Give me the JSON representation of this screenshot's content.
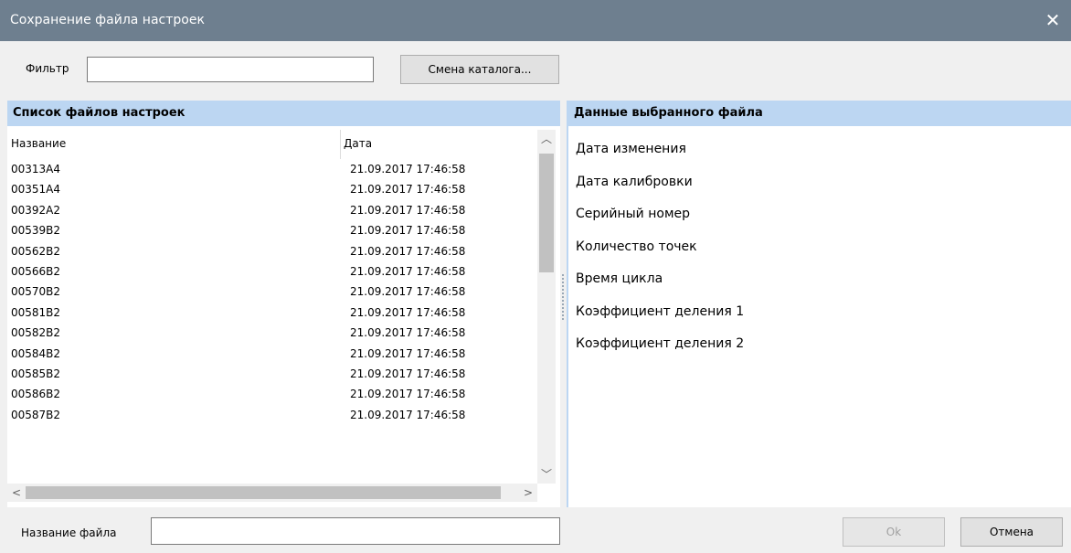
{
  "window": {
    "title": "Сохранение файла настроек",
    "close_glyph": "✕"
  },
  "toolbar": {
    "filter_label": "Фильтр",
    "filter_value": "",
    "change_dir_label": "Смена каталога..."
  },
  "file_list": {
    "header": "Список файлов настроек",
    "columns": [
      "Название",
      "Дата"
    ],
    "rows": [
      {
        "name": "00313A4",
        "date": "21.09.2017 17:46:58"
      },
      {
        "name": "00351A4",
        "date": "21.09.2017 17:46:58"
      },
      {
        "name": "00392A2",
        "date": "21.09.2017 17:46:58"
      },
      {
        "name": "00539B2",
        "date": "21.09.2017 17:46:58"
      },
      {
        "name": "00562B2",
        "date": "21.09.2017 17:46:58"
      },
      {
        "name": "00566B2",
        "date": "21.09.2017 17:46:58"
      },
      {
        "name": "00570B2",
        "date": "21.09.2017 17:46:58"
      },
      {
        "name": "00581B2",
        "date": "21.09.2017 17:46:58"
      },
      {
        "name": "00582B2",
        "date": "21.09.2017 17:46:58"
      },
      {
        "name": "00584B2",
        "date": "21.09.2017 17:46:58"
      },
      {
        "name": "00585B2",
        "date": "21.09.2017 17:46:58"
      },
      {
        "name": "00586B2",
        "date": "21.09.2017 17:46:58"
      },
      {
        "name": "00587B2",
        "date": "21.09.2017 17:46:58"
      }
    ]
  },
  "details": {
    "header": "Данные выбранного файла",
    "fields": [
      "Дата изменения",
      "Дата калибровки",
      "Серийный номер",
      "Количество точек",
      "Время цикла",
      "Коэффициент деления 1",
      "Коэффициент деления 2"
    ]
  },
  "footer": {
    "filename_label": "Название файла",
    "filename_value": "",
    "ok_label": "Ok",
    "cancel_label": "Отмена"
  },
  "colors": {
    "titlebar": "#6e7f8f",
    "pane_header": "#bcd6f2",
    "background": "#f0f0f0"
  }
}
